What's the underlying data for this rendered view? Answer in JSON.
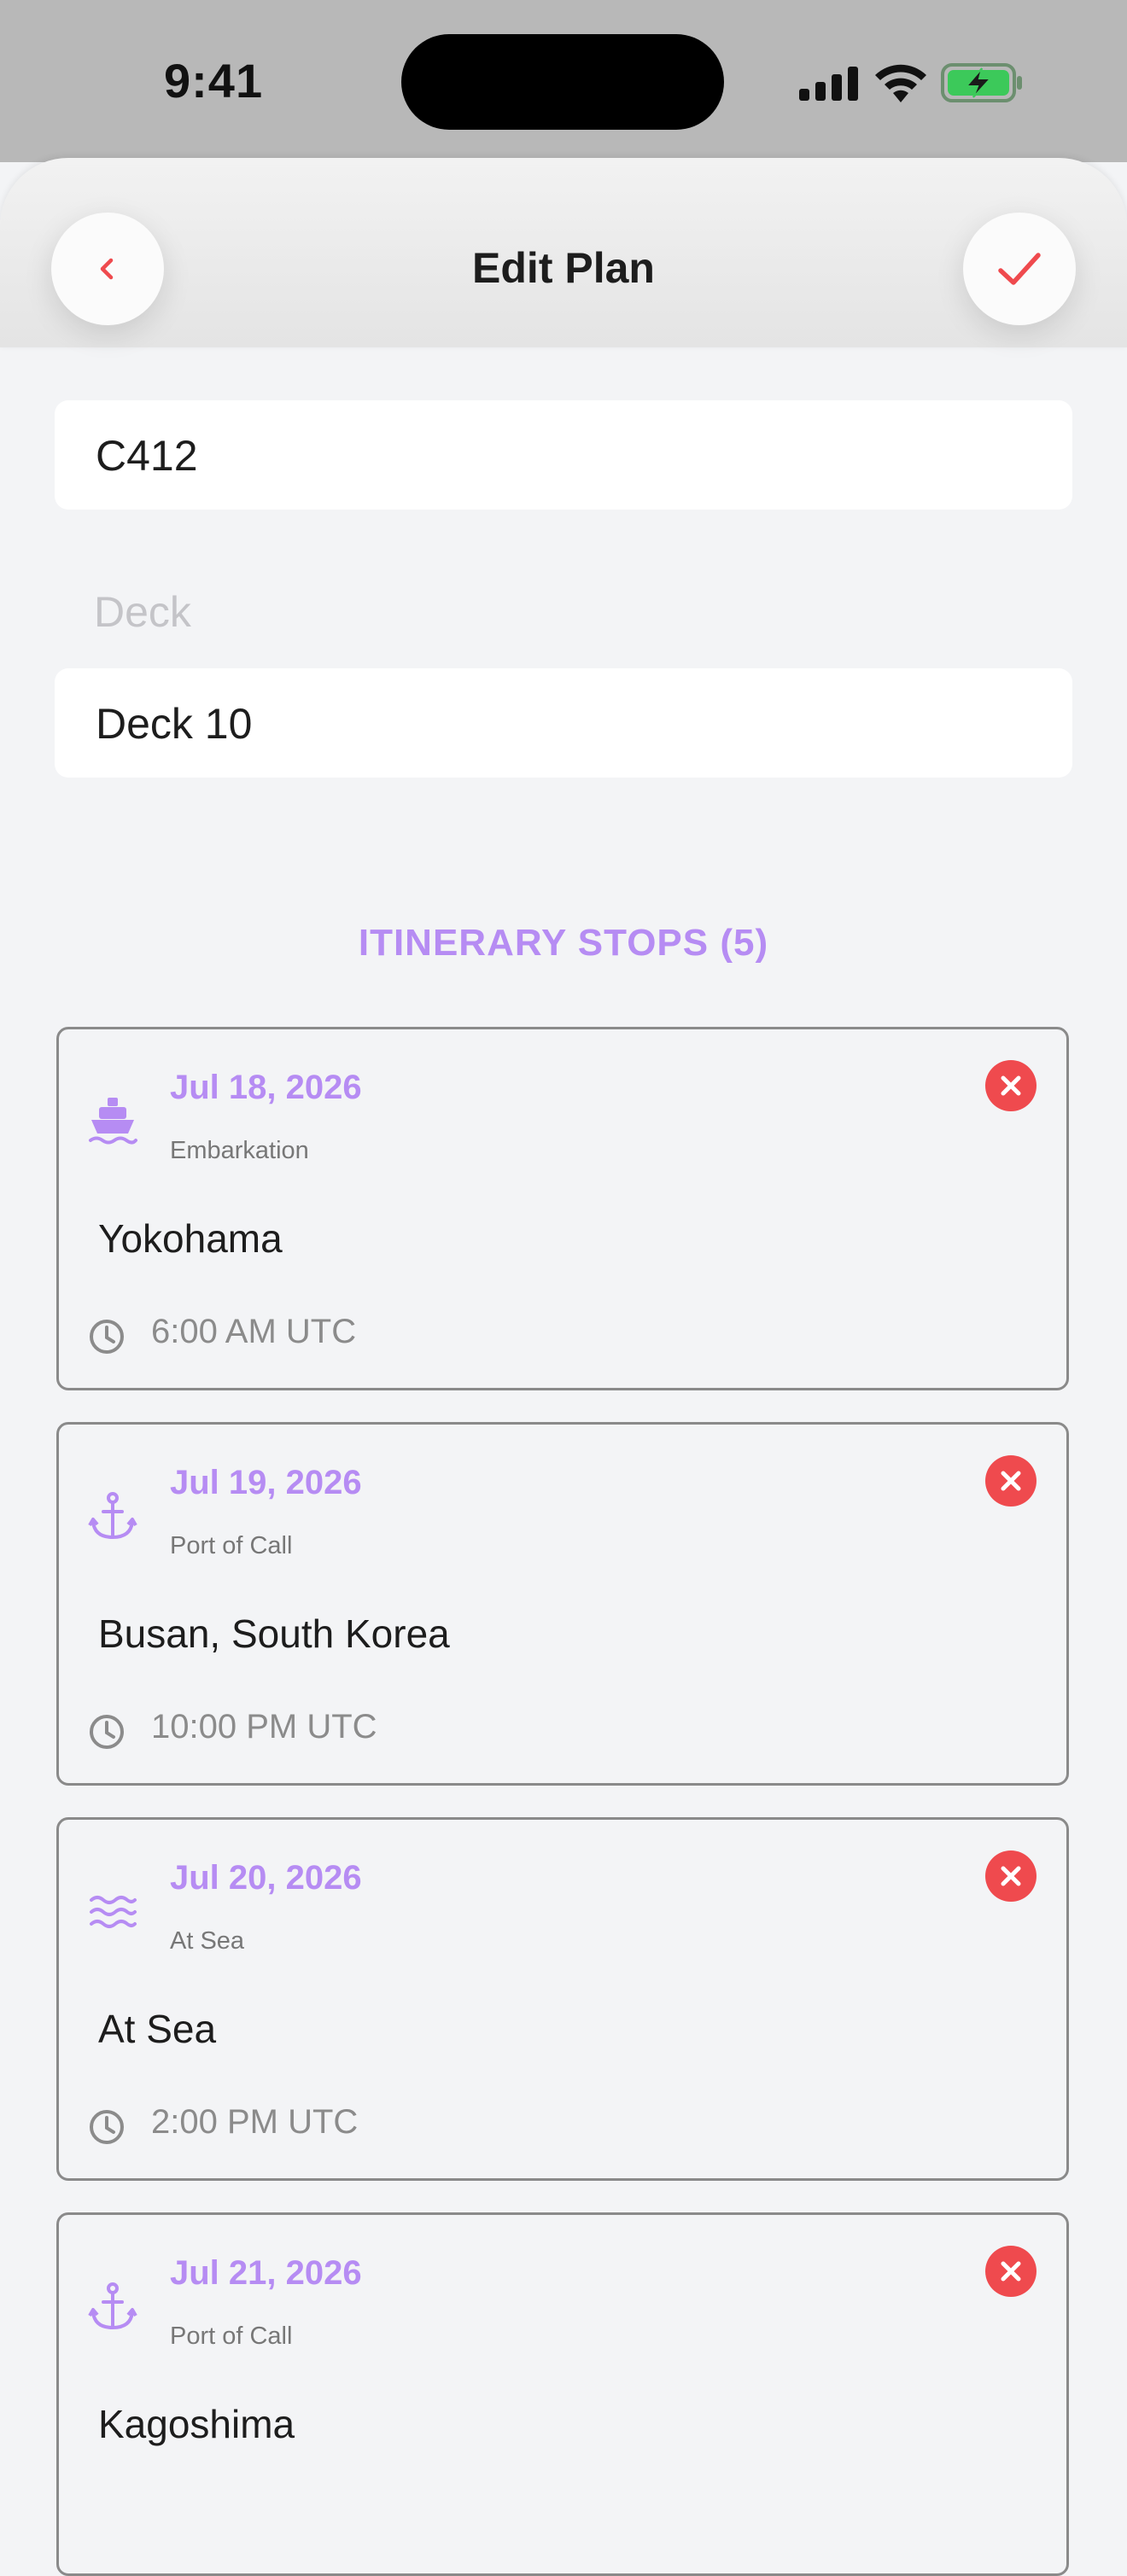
{
  "status_bar": {
    "time": "9:41"
  },
  "header": {
    "title": "Edit Plan"
  },
  "form": {
    "cabin_value": "C412",
    "deck_label": "Deck",
    "deck_value": "Deck 10"
  },
  "itinerary": {
    "section_title": "ITINERARY STOPS (5)",
    "stops": [
      {
        "date": "Jul 18, 2026",
        "kind": "Embarkation",
        "port": "Yokohama",
        "time": "6:00 AM UTC",
        "icon": "ship-icon"
      },
      {
        "date": "Jul 19, 2026",
        "kind": "Port of Call",
        "port": "Busan, South Korea",
        "time": "10:00 PM UTC",
        "icon": "anchor-icon"
      },
      {
        "date": "Jul 20, 2026",
        "kind": "At Sea",
        "port": "At Sea",
        "time": "2:00 PM UTC",
        "icon": "waves-icon"
      },
      {
        "date": "Jul 21, 2026",
        "kind": "Port of Call",
        "port": "Kagoshima",
        "time": "",
        "icon": "anchor-icon"
      }
    ]
  },
  "colors": {
    "accent_purple": "#b68cf3",
    "danger_red": "#ef4a4e",
    "battery_green": "#3cc95a"
  }
}
